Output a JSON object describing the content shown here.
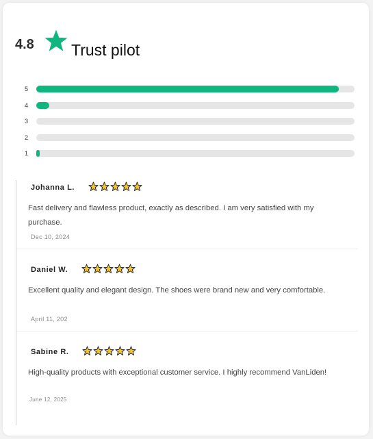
{
  "header": {
    "rating": "4.8",
    "brand": "Trust pilot",
    "brand_icon": "trustpilot-star-icon",
    "accent_color": "#0fb77f"
  },
  "distribution": [
    {
      "label": "5",
      "fraction": 0.95
    },
    {
      "label": "4",
      "fraction": 0.04
    },
    {
      "label": "3",
      "fraction": 0.0
    },
    {
      "label": "2",
      "fraction": 0.0
    },
    {
      "label": "1",
      "fraction": 0.01
    }
  ],
  "reviews": [
    {
      "name": "Johanna L.",
      "stars": 5,
      "text": "Fast delivery and flawless product, exactly as described. I am very satisfied with my purchase.",
      "date": "Dec 10, 2024"
    },
    {
      "name": "Daniel W.",
      "stars": 5,
      "text": "Excellent quality and elegant design. The shoes were brand new and very comfortable.",
      "date": "April 11, 202"
    },
    {
      "name": "Sabine R.",
      "stars": 5,
      "text": "High-quality products with exceptional customer service. I highly recommend VanLiden!",
      "date": "June 12, 2025"
    }
  ]
}
